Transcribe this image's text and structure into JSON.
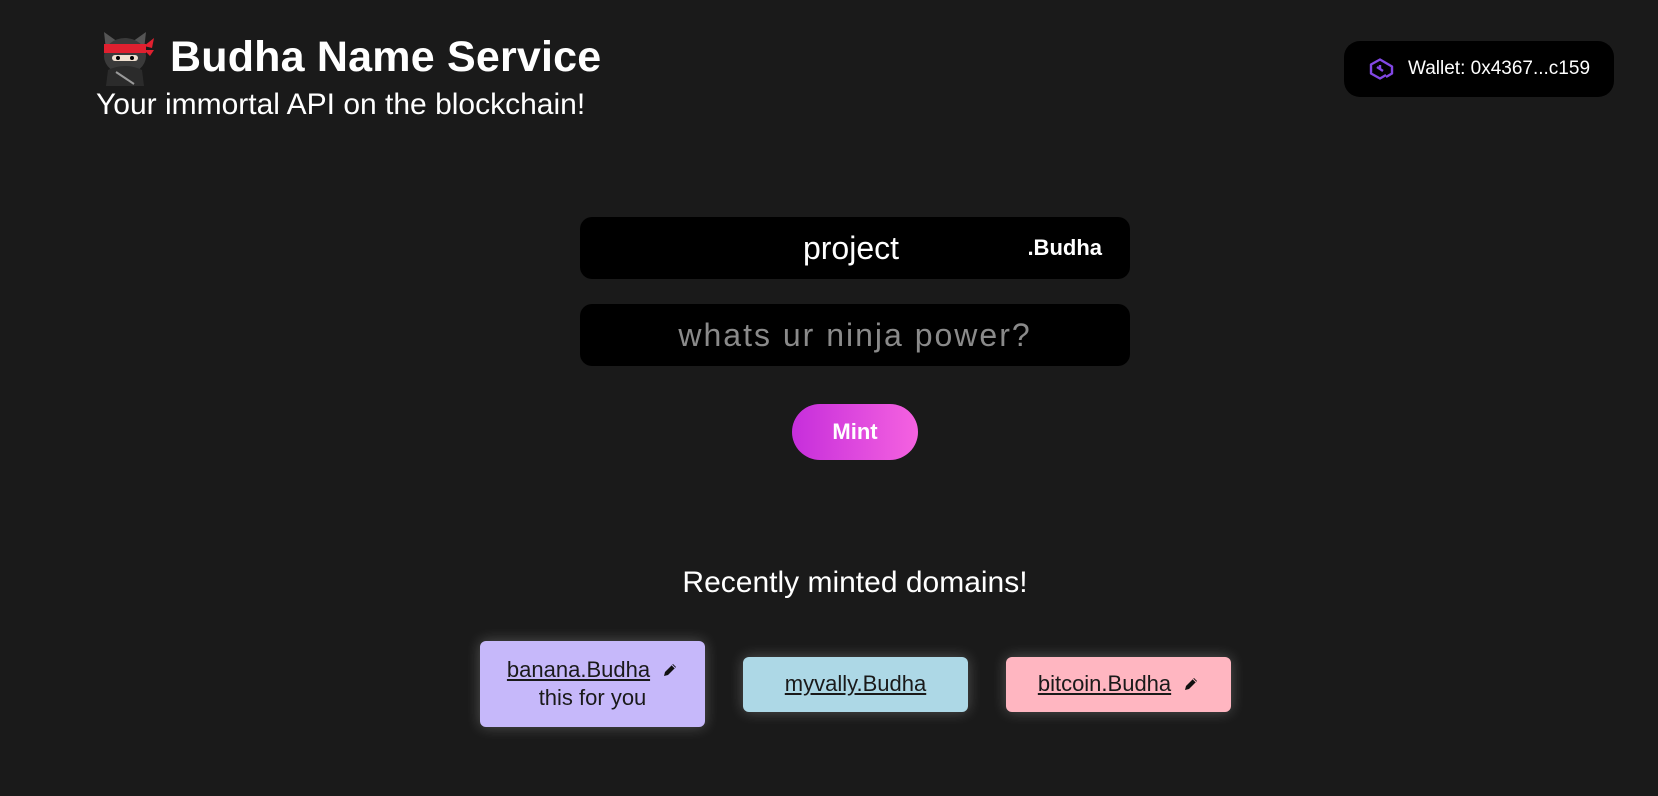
{
  "header": {
    "logo_icon": "ninja-cat-icon",
    "title": "Budha Name Service",
    "subtitle": "Your immortal API on the blockchain!"
  },
  "wallet": {
    "icon": "polygon-icon",
    "label": "Wallet: 0x4367...c159"
  },
  "form": {
    "domain_value": "project",
    "tld": ".Budha",
    "record_placeholder": "whats ur ninja power?",
    "mint_label": "Mint"
  },
  "recent": {
    "title": "Recently minted domains!",
    "domains": [
      {
        "name": "banana.Budha",
        "record": "this for you",
        "editable": true,
        "color": "#c6b8fa"
      },
      {
        "name": "myvally.Budha",
        "record": "",
        "editable": false,
        "color": "#add8e6"
      },
      {
        "name": "bitcoin.Budha",
        "record": "",
        "editable": true,
        "color": "#ffb6c1"
      }
    ]
  },
  "colors": {
    "background": "#1a1a1a",
    "mint_gradient_start": "#c62edb",
    "mint_gradient_end": "#f562e0",
    "polygon_purple": "#8247e5"
  }
}
